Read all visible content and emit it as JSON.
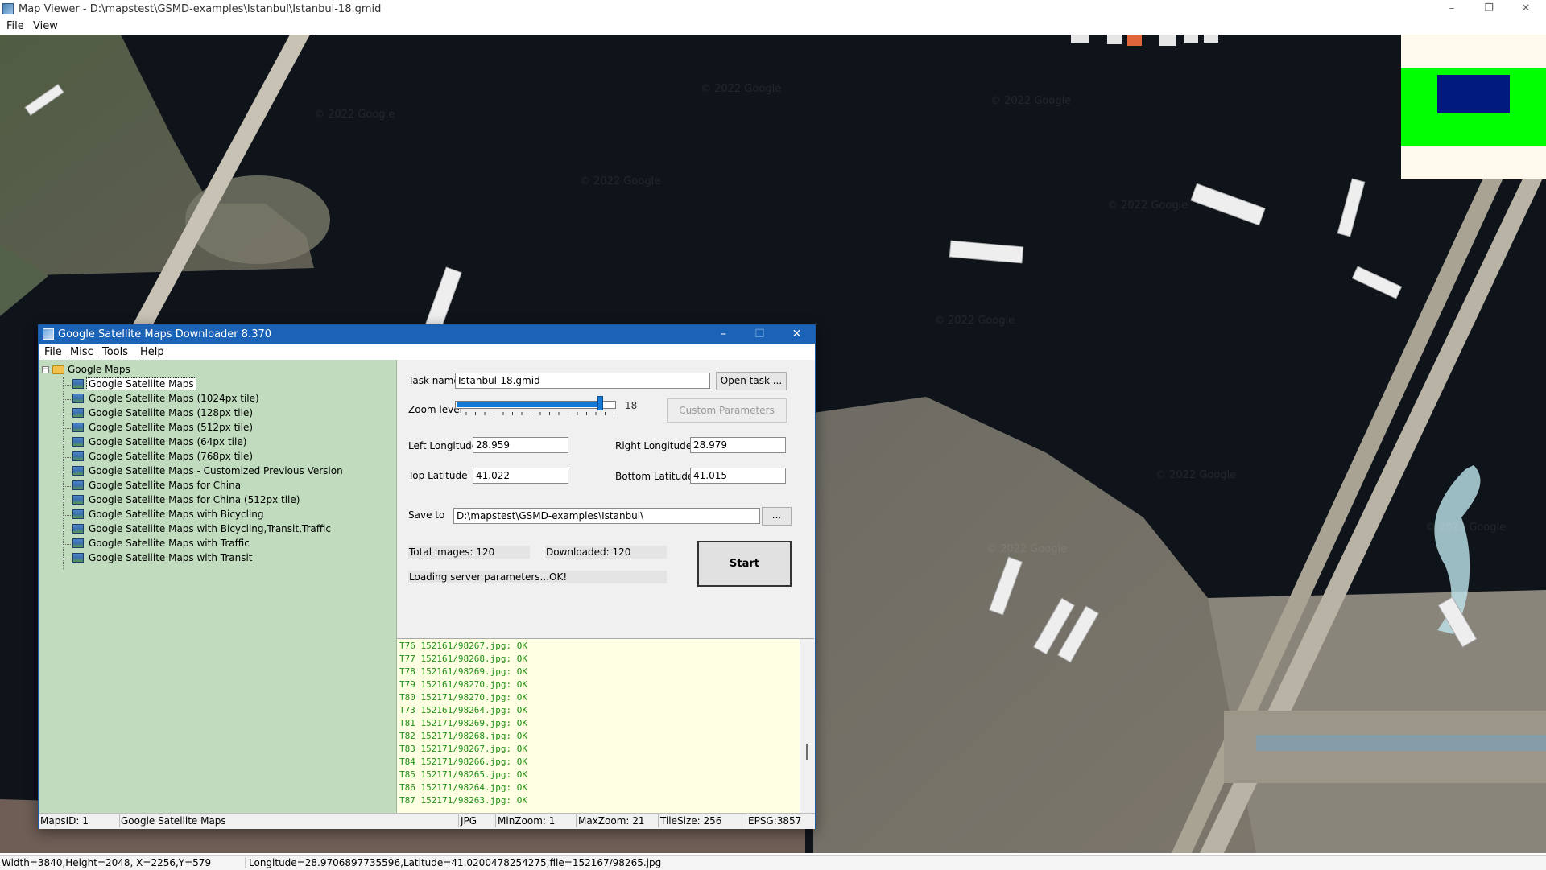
{
  "window": {
    "title": "Map Viewer - D:\\mapstest\\GSMD-examples\\Istanbul\\Istanbul-18.gmid",
    "controls": {
      "minimize": "–",
      "restore": "❐",
      "close": "✕"
    }
  },
  "menubar": {
    "file": "File",
    "view": "View"
  },
  "map": {
    "watermark": "© 2022 Google",
    "minimap_colors": {
      "background": "#fff8ec",
      "band": "#00ff00",
      "viewport": "#001a80"
    }
  },
  "statusbar": {
    "dims": "Width=3840,Height=2048, X=2256,Y=579",
    "coords": "Longitude=28.9706897735596,Latitude=41.0200478254275,file=152167/98265.jpg"
  },
  "dialog": {
    "title": "Google Satellite Maps Downloader 8.370",
    "controls": {
      "minimize": "–",
      "maximize": "☐",
      "close": "✕"
    },
    "menu": {
      "file": "File",
      "misc": "Misc",
      "tools": "Tools",
      "help": "Help"
    },
    "tree": {
      "root": "Google Maps",
      "expander": "−",
      "items": [
        "Google Satellite Maps",
        "Google Satellite Maps (1024px tile)",
        "Google Satellite Maps (128px tile)",
        "Google Satellite Maps (512px tile)",
        "Google Satellite Maps (64px tile)",
        "Google Satellite Maps (768px tile)",
        "Google Satellite Maps - Customized Previous Version",
        "Google Satellite Maps for China",
        "Google Satellite Maps for China (512px tile)",
        "Google Satellite Maps with Bicycling",
        "Google Satellite Maps with Bicycling,Transit,Traffic",
        "Google Satellite Maps with Traffic",
        "Google Satellite Maps with Transit"
      ],
      "selected_index": 0
    },
    "form": {
      "task_name_label": "Task name",
      "task_name_value": "Istanbul-18.gmid",
      "open_task_button": "Open task ...",
      "zoom_label": "Zoom level",
      "zoom_value": "18",
      "zoom_fraction": 0.9,
      "custom_params_button": "Custom Parameters",
      "left_lon_label": "Left Longitude",
      "left_lon_value": "28.959",
      "right_lon_label": "Right Longitude",
      "right_lon_value": "28.979",
      "top_lat_label": "Top Latitude",
      "top_lat_value": "41.022",
      "bottom_lat_label": "Bottom Latitude",
      "bottom_lat_value": "41.015",
      "save_to_label": "Save to",
      "save_to_value": "D:\\mapstest\\GSMD-examples\\Istanbul\\",
      "browse_button": "...",
      "total_images": "Total images: 120",
      "downloaded": "Downloaded: 120",
      "status_text": "Loading server parameters...OK!",
      "start_button": "Start"
    },
    "log": [
      "T76 152161/98267.jpg: OK",
      "T77 152161/98268.jpg: OK",
      "T78 152161/98269.jpg: OK",
      "T79 152161/98270.jpg: OK",
      "T80 152171/98270.jpg: OK",
      "T73 152161/98264.jpg: OK",
      "T81 152171/98269.jpg: OK",
      "T82 152171/98268.jpg: OK",
      "T83 152171/98267.jpg: OK",
      "T84 152171/98266.jpg: OK",
      "T85 152171/98265.jpg: OK",
      "T86 152171/98264.jpg: OK",
      "T87 152171/98263.jpg: OK"
    ],
    "status": {
      "maps_id": "MapsID: 1",
      "map_name": "Google Satellite Maps",
      "format": "JPG",
      "min_zoom": "MinZoom: 1",
      "max_zoom": "MaxZoom: 21",
      "tile_size": "TileSize: 256",
      "epsg": "EPSG:3857"
    }
  }
}
